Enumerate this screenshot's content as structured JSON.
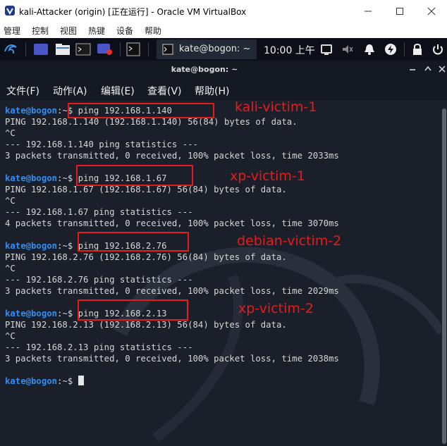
{
  "window": {
    "title": "kali-Attacker (origin) [正在运行] - Oracle VM VirtualBox",
    "menu": [
      "管理",
      "控制",
      "视图",
      "热键",
      "设备",
      "帮助"
    ]
  },
  "panel": {
    "task_label": "kate@bogon: ~",
    "clock": "10:00 上午"
  },
  "terminal": {
    "title": "kate@bogon: ~",
    "menu": [
      "文件(F)",
      "动作(A)",
      "编辑(E)",
      "查看(V)",
      "帮助(H)"
    ],
    "user_host": "kate@bogon",
    "prompt_symbol": ":~$ ",
    "sessions": [
      {
        "command": "ping 192.168.1.140",
        "output": [
          "PING 192.168.1.140 (192.168.1.140) 56(84) bytes of data.",
          "^C",
          "--- 192.168.1.140 ping statistics ---",
          "3 packets transmitted, 0 received, 100% packet loss, time 2033ms"
        ],
        "annotation": "kali-victim-1"
      },
      {
        "command": "ping 192.168.1.67",
        "output": [
          "PING 192.168.1.67 (192.168.1.67) 56(84) bytes of data.",
          "^C",
          "--- 192.168.1.67 ping statistics ---",
          "4 packets transmitted, 0 received, 100% packet loss, time 3070ms"
        ],
        "annotation": "xp-victim-1"
      },
      {
        "command": "ping 192.168.2.76",
        "output": [
          "PING 192.168.2.76 (192.168.2.76) 56(84) bytes of data.",
          "^C",
          "--- 192.168.2.76 ping statistics ---",
          "3 packets transmitted, 0 received, 100% packet loss, time 2029ms"
        ],
        "annotation": "debian-victim-2"
      },
      {
        "command": "ping 192.168.2.13",
        "output": [
          "PING 192.168.2.13 (192.168.2.13) 56(84) bytes of data.",
          "^C",
          "--- 192.168.2.13 ping statistics ---",
          "3 packets transmitted, 0 received, 100% packet loss, time 2038ms"
        ],
        "annotation": "xp-victim-2"
      }
    ]
  },
  "colors": {
    "annotation_red": "#e51c1c",
    "prompt_blue": "#2f8ef0",
    "terminal_bg": "#1b1f2a",
    "panel_bg": "#0c0f17"
  },
  "icons": [
    "virtualbox-app-icon",
    "minimize-icon",
    "maximize-icon",
    "close-icon",
    "kali-dragon-menu-icon",
    "workspace-icon",
    "file-manager-icon",
    "terminal-icon",
    "screen-recorder-icon",
    "terminal-task-icon",
    "notes-icon",
    "volume-muted-icon",
    "notification-bell-icon",
    "network-icon",
    "lock-icon",
    "power-icon",
    "terminal-minimize-icon",
    "terminal-maximize-icon",
    "terminal-close-icon"
  ]
}
